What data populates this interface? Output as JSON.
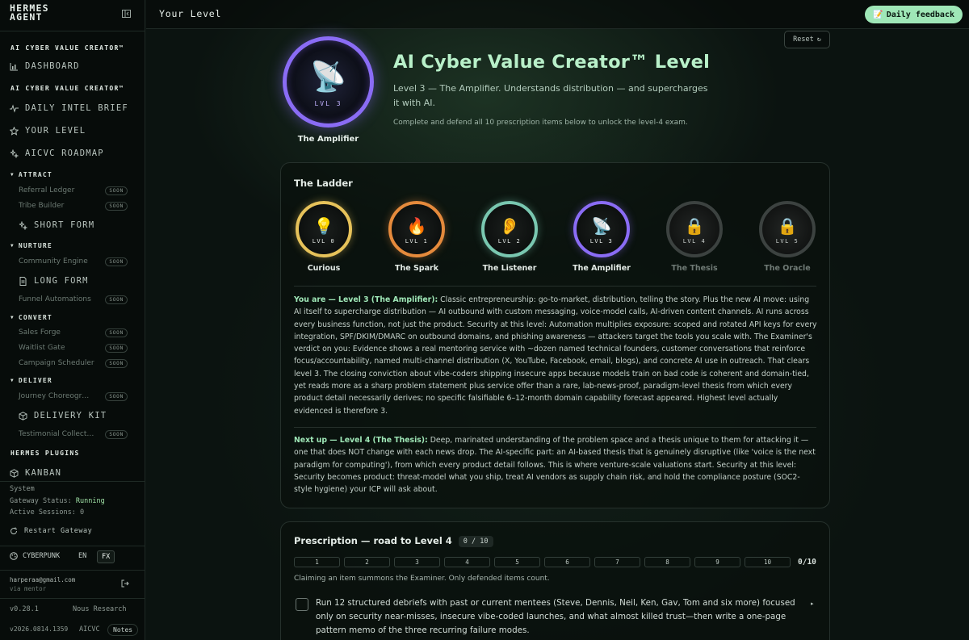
{
  "sidebar": {
    "brand": "HERMES AGENT",
    "sections": [
      {
        "title": "AI CYBER VALUE CREATOR™",
        "nav": [
          {
            "label": "DASHBOARD",
            "icon": "bar-chart-icon"
          }
        ]
      },
      {
        "title": "AI CYBER VALUE CREATOR™",
        "nav": [
          {
            "label": "DAILY INTEL BRIEF",
            "icon": "pulse-icon"
          },
          {
            "label": "YOUR LEVEL",
            "icon": "star-icon"
          },
          {
            "label": "AICVC ROADMAP",
            "icon": "sparkle-icon"
          }
        ]
      }
    ],
    "groups": {
      "attract": {
        "label": "ATTRACT",
        "items": [
          "Referral Ledger",
          "Tribe Builder"
        ],
        "nav": "SHORT FORM"
      },
      "nurture": {
        "label": "NURTURE",
        "items": [
          "Community Engine"
        ],
        "nav": "LONG FORM",
        "after": "Funnel Automations"
      },
      "convert": {
        "label": "CONVERT",
        "items": [
          "Sales Forge",
          "Waitlist Gate",
          "Campaign Scheduler"
        ]
      },
      "deliver": {
        "label": "DELIVER",
        "items": [
          "Journey Choreogr…"
        ],
        "nav": "DELIVERY KIT",
        "after": "Testimonial Collect…"
      }
    },
    "soon_label": "SOON",
    "plugins_title": "HERMES PLUGINS",
    "plugins_nav": "KANBAN",
    "system": {
      "title": "System",
      "gateway_label": "Gateway Status:",
      "gateway_value": "Running",
      "sessions_label": "Active Sessions:",
      "sessions_value": "0"
    },
    "restart_label": "Restart Gateway",
    "theme": "CYBERPUNK",
    "lang_en": "EN",
    "lang_fx": "FX",
    "user_email": "harperaa@gmail.com",
    "user_sub": "via mentor",
    "version": "v0.28.1",
    "company": "Nous Research",
    "build": "v2026.0814.1359",
    "app": "AICVC",
    "notes_label": "Notes"
  },
  "topbar": {
    "title": "Your Level",
    "feedback_label": "Daily feedback",
    "feedback_icon": "memo-icon"
  },
  "hero": {
    "reset_label": "Reset",
    "badge_level": "LVL 3",
    "badge_name": "The Amplifier",
    "title": "AI Cyber Value Creator™ Level",
    "description": "Level 3 — The Amplifier. Understands distribution — and supercharges it with AI.",
    "note": "Complete and defend all 10 prescription items below to unlock the level-4 exam.",
    "accent": "#8a6cf5"
  },
  "ladder": {
    "title": "The Ladder",
    "levels": [
      {
        "lvl": "LVL 0",
        "name": "Curious",
        "glyph": "💡",
        "color": "#e6c25a",
        "locked": false
      },
      {
        "lvl": "LVL 1",
        "name": "The Spark",
        "glyph": "🔥",
        "color": "#e58a3c",
        "locked": false
      },
      {
        "lvl": "LVL 2",
        "name": "The Listener",
        "glyph": "👂",
        "color": "#79c7b0",
        "locked": false
      },
      {
        "lvl": "LVL 3",
        "name": "The Amplifier",
        "glyph": "📡",
        "color": "#8a6cf5",
        "locked": false
      },
      {
        "lvl": "LVL 4",
        "name": "The Thesis",
        "glyph": "🔒",
        "color": "#3c4240",
        "locked": true
      },
      {
        "lvl": "LVL 5",
        "name": "The Oracle",
        "glyph": "🔒",
        "color": "#3c4240",
        "locked": true
      }
    ],
    "you_are_label": "You are — Level 3 (The Amplifier):",
    "you_are_text": "Classic entrepreneurship: go-to-market, distribution, telling the story. Plus the new AI move: using AI itself to supercharge distribution — AI outbound with custom messaging, voice-model calls, AI-driven content channels. AI runs across every business function, not just the product. Security at this level: Automation multiplies exposure: scoped and rotated API keys for every integration, SPF/DKIM/DMARC on outbound domains, and phishing awareness — attackers target the tools you scale with. The Examiner's verdict on you: Evidence shows a real mentoring service with ~dozen named technical founders, customer conversations that reinforce focus/accountability, named multi-channel distribution (X, YouTube, Facebook, email, blogs), and concrete AI use in outreach. That clears level 3. The closing conviction about vibe-coders shipping insecure apps because models train on bad code is coherent and domain-tied, yet reads more as a sharp problem statement plus service offer than a rare, lab-news-proof, paradigm-level thesis from which every product detail necessarily derives; no specific falsifiable 6–12-month domain capability forecast appeared. Highest level actually evidenced is therefore 3.",
    "next_label": "Next up — Level 4 (The Thesis):",
    "next_text": "Deep, marinated understanding of the problem space and a thesis unique to them for attacking it — one that does NOT change with each news drop. The AI-specific part: an AI-based thesis that is genuinely disruptive (like 'voice is the next paradigm for computing'), from which every product detail follows. This is where venture-scale valuations start. Security at this level: Security becomes product: threat-model what you ship, treat AI vendors as supply chain risk, and hold the compliance posture (SOC2-style hygiene) your ICP will ask about."
  },
  "prescription": {
    "title": "Prescription — road to Level 4",
    "count": "0 / 10",
    "steps": [
      "1",
      "2",
      "3",
      "4",
      "5",
      "6",
      "7",
      "8",
      "9",
      "10"
    ],
    "total": "0/10",
    "note": "Claiming an item summons the Examiner. Only defended items count.",
    "items": [
      {
        "text": "Run 12 structured debriefs with past or current mentees (Steve, Dennis, Neil, Ken, Gav, Tom and six more) focused only on security near-misses, insecure vibe-coded launches, and what almost killed trust—then write a one-page pattern memo of the three recurring failure modes.",
        "checked": false
      }
    ]
  }
}
